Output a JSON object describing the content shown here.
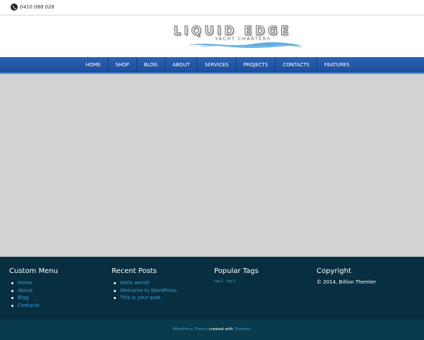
{
  "topbar": {
    "phone": "0410 088 028"
  },
  "logo": {
    "title": "LIQUID EDGE",
    "subtitle": "YACHT CHARTERS"
  },
  "nav": {
    "items": [
      "HOME",
      "SHOP",
      "BLOG",
      "ABOUT",
      "SERVICES",
      "PROJECTS",
      "CONTACTS",
      "FEATURES"
    ]
  },
  "footer": {
    "custom_menu": {
      "title": "Custom Menu",
      "items": [
        "Home",
        "About",
        "Blog",
        "Contacts"
      ]
    },
    "recent_posts": {
      "title": "Recent Posts",
      "items": [
        "Hello world!",
        "Welcome to WordPress",
        "This is your post"
      ]
    },
    "popular_tags": {
      "title": "Popular Tags",
      "tags": [
        "tag 1",
        "tag 2"
      ]
    },
    "copyright": {
      "title": "Copyright",
      "text": "© 2014, Billion Themler"
    }
  },
  "bottom": {
    "theme_link": "WordPress Theme",
    "created_with": " created with ",
    "themler_link": "Themler",
    "period": "."
  },
  "colors": {
    "nav_bg": "#1d4d99",
    "nav_accent": "#4aa0e6",
    "content_bg": "#d2d2d2",
    "footer_bg": "#082f40",
    "link": "#3a9fd8"
  }
}
